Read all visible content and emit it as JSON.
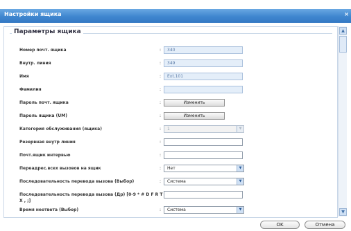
{
  "window": {
    "title": "Настройки ящика",
    "close_symbol": "×"
  },
  "section": {
    "legend": "Параметры ящика"
  },
  "rows": [
    {
      "label": "Номер почт. ящика",
      "value": "340"
    },
    {
      "label": "Внутр. линия",
      "value": "349"
    },
    {
      "label": "Имя",
      "value": "Ext.101"
    },
    {
      "label": "Фамилия",
      "value": ""
    },
    {
      "label": "Пароль почт. ящика",
      "button": "Изменить"
    },
    {
      "label": "Пароль ящика (UM)",
      "button": "Изменить"
    },
    {
      "label": "Категория обслуживания (ящика)",
      "select": "1"
    },
    {
      "label": "Резервная внутр линия",
      "value": ""
    },
    {
      "label": "Почт.ящик интервью",
      "value": ""
    },
    {
      "label": "Переадрес.всех вызовов на ящик",
      "select": "Нет"
    },
    {
      "label": "Последовательность перевода вызова (Выбор)",
      "select": "Система"
    },
    {
      "label": "Последовательность перевода вызова (Др) [0-9 * # D F R T X , ;]",
      "value": ""
    },
    {
      "label": "Время неответа (Выбор)",
      "select": "Система"
    }
  ],
  "icons": {
    "scroll_up": "arrow-up-icon",
    "scroll_down": "arrow-down-icon",
    "dropdown": "chevron-down-icon"
  },
  "footer": {
    "ok": "OK",
    "cancel": "Отмена"
  },
  "colors": {
    "titlebar": "#3f86cf",
    "field_filled": "#e4eef9",
    "border": "#a8bfdc"
  }
}
